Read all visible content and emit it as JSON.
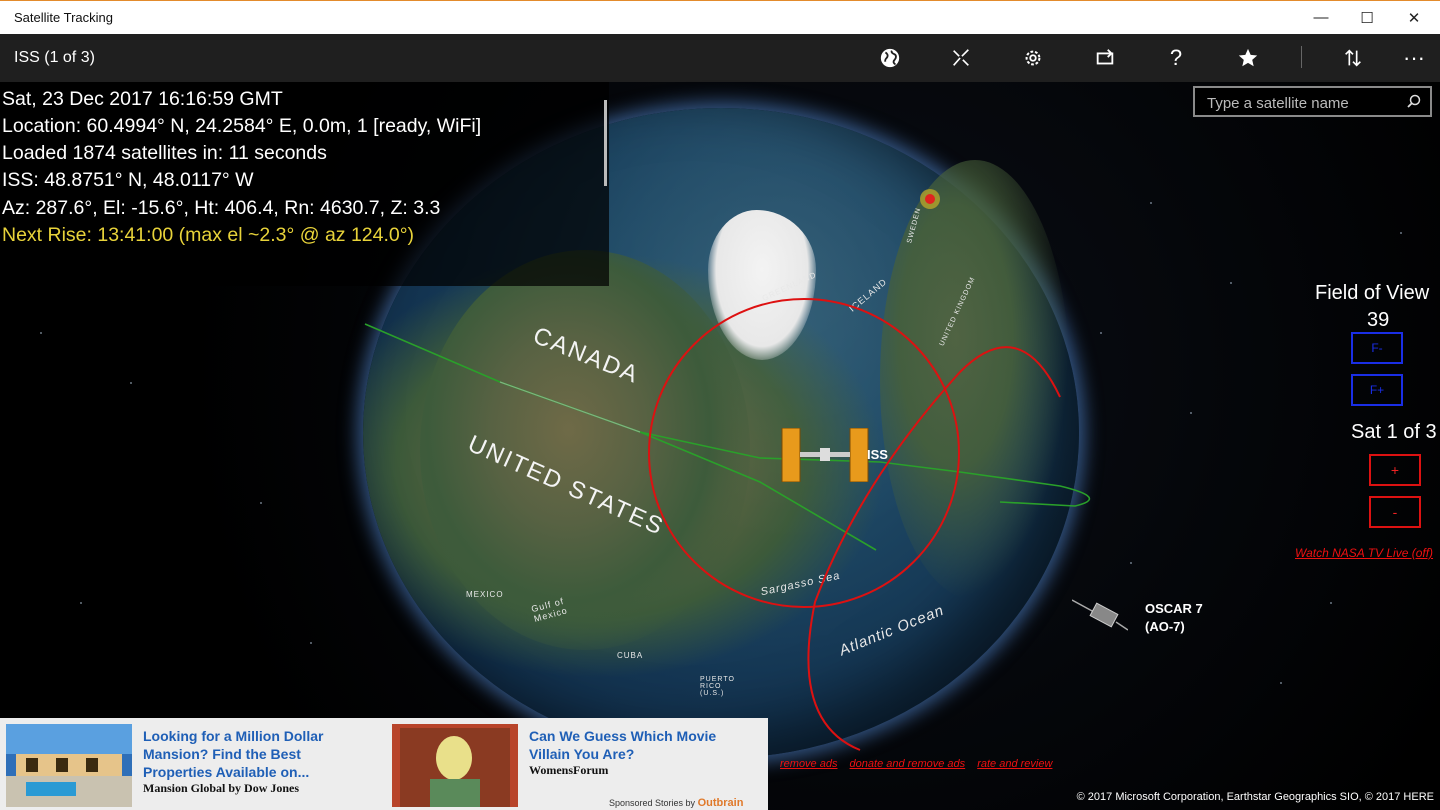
{
  "window": {
    "title": "Satellite Tracking",
    "controls": {
      "minimize": "—",
      "maximize": "☐",
      "close": "✕"
    }
  },
  "appbar": {
    "title": "ISS (1 of 3)",
    "icons": [
      "globe-icon",
      "track-icon",
      "settings-icon",
      "rotate-icon",
      "help-icon",
      "favorite-icon",
      "sort-icon",
      "more-icon"
    ],
    "help_label": "?",
    "more_label": "···"
  },
  "info": {
    "datetime": "Sat, 23 Dec 2017 16:16:59 GMT",
    "location": "Location:  60.4994° N, 24.2584° E, 0.0m, 1 [ready, WiFi]",
    "loaded": "Loaded 1874 satellites in: 11 seconds",
    "iss_position": "ISS:  48.8751° N, 48.0117° W",
    "az_el": "Az:  287.6°, El: -15.6°, Ht: 406.4, Rn: 4630.7, Z: 3.3",
    "next_rise": "Next Rise:  13:41:00 (max el ~2.3° @ az 124.0°)"
  },
  "search": {
    "placeholder": "Type a satellite name"
  },
  "controls": {
    "fov_label": "Field of View",
    "fov_value": "39",
    "fov_minus": "F-",
    "fov_plus": "F+",
    "sat_count": "Sat 1 of 3",
    "sat_plus": "+",
    "sat_minus": "-",
    "nasa_link": "Watch NASA TV Live (off)"
  },
  "map": {
    "canada": "CANADA",
    "united_states": "UNITED STATES",
    "iceland": "ICELAND",
    "greenland": "GREENLAND",
    "sargasso": "Sargasso Sea",
    "atlantic": "Atlantic Ocean",
    "gulf": "Gulf of Mexico",
    "mexico": "MEXICO",
    "cuba": "CUBA",
    "puerto_rico": "PUERTO RICO (U.S.)",
    "sweden": "SWEDEN",
    "uk": "UNITED KINGDOM"
  },
  "satellites": {
    "iss_label": "ISS",
    "oscar_line1": "OSCAR 7",
    "oscar_line2": "(AO-7)"
  },
  "ads": [
    {
      "title": "Looking for a Million Dollar Mansion? Find the Best Properties Available on...",
      "source": "Mansion Global by Dow Jones"
    },
    {
      "title": "Can We Guess Which Movie Villain You Are?",
      "source": "WomensForum"
    }
  ],
  "sponsored": {
    "prefix": "Sponsored Stories by",
    "brand": "Outbrain"
  },
  "bottom_links": [
    "remove ads",
    "donate and remove ads",
    "rate and review"
  ],
  "copyright": "© 2017 Microsoft Corporation, Earthstar Geographics  SIO, © 2017 HERE",
  "colors": {
    "accent_red": "#dd1111",
    "accent_blue": "#1a2ee6",
    "rise_yellow": "#e8d33a",
    "ground_track": "#2aa02a"
  }
}
